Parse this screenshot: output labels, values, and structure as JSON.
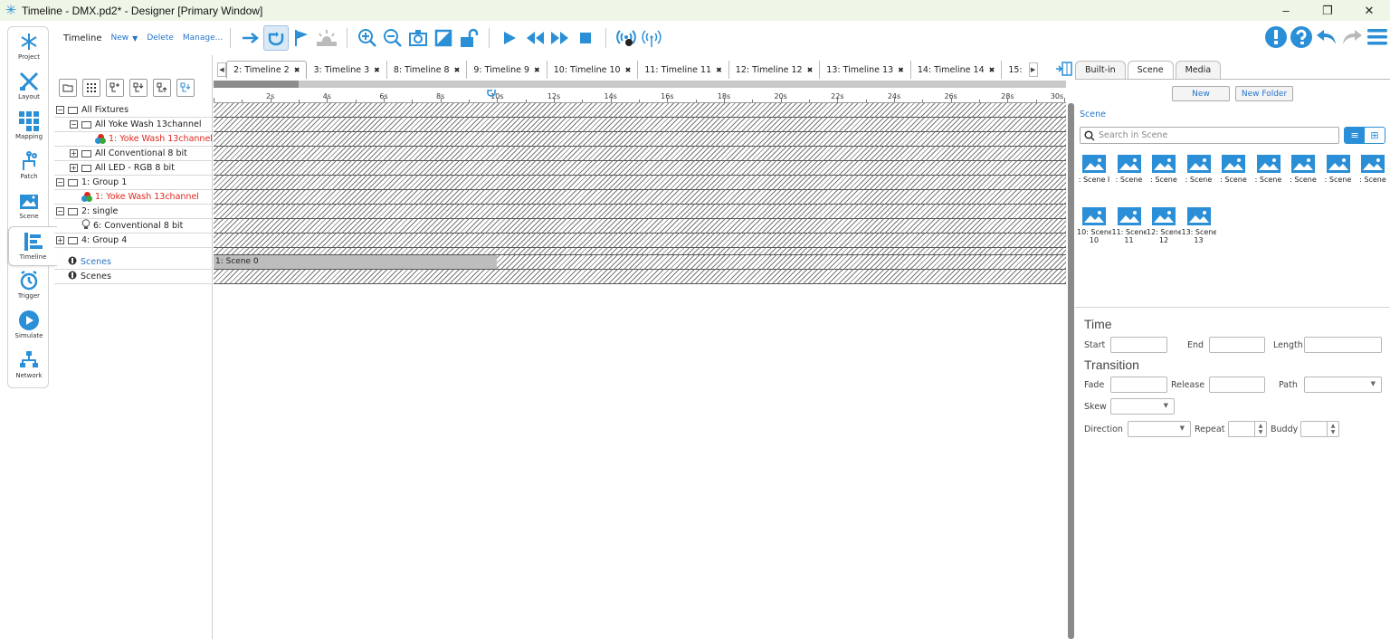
{
  "window": {
    "title": "Timeline - DMX.pd2* - Designer [Primary Window]",
    "minimize": "–",
    "maximize": "❐",
    "close": "✕"
  },
  "sidebar": {
    "items": [
      {
        "label": "Project",
        "icon": "project-icon"
      },
      {
        "label": "Layout",
        "icon": "layout-icon"
      },
      {
        "label": "Mapping",
        "icon": "mapping-icon"
      },
      {
        "label": "Patch",
        "icon": "patch-icon"
      },
      {
        "label": "Scene",
        "icon": "scene-icon"
      },
      {
        "label": "Timeline",
        "icon": "timeline-icon"
      },
      {
        "label": "Trigger",
        "icon": "trigger-icon"
      },
      {
        "label": "Simulate",
        "icon": "simulate-icon"
      },
      {
        "label": "Network",
        "icon": "network-icon"
      }
    ],
    "active": "Timeline"
  },
  "toolbar": {
    "title": "Timeline",
    "new_label": "New",
    "new_caret": "▼",
    "delete_label": "Delete",
    "manage_label": "Manage..."
  },
  "tree": {
    "rows": [
      {
        "label": "All Fixtures",
        "type": "folder",
        "pm": "⊟",
        "indent": 0,
        "red": false
      },
      {
        "label": "All Yoke Wash 13channel",
        "type": "folder",
        "pm": "⊟",
        "indent": 1,
        "red": false
      },
      {
        "label": "1: Yoke Wash 13channel",
        "type": "rgb",
        "pm": "",
        "indent": 2,
        "red": true
      },
      {
        "label": "All Conventional 8 bit",
        "type": "folder",
        "pm": "⊞",
        "indent": 1,
        "red": false
      },
      {
        "label": "All LED - RGB 8 bit",
        "type": "folder",
        "pm": "⊞",
        "indent": 1,
        "red": false
      },
      {
        "label": "1: Group 1",
        "type": "folder",
        "pm": "⊟",
        "indent": 0,
        "red": false
      },
      {
        "label": "1: Yoke Wash 13channel",
        "type": "rgb",
        "pm": "",
        "indent": 1,
        "red": true
      },
      {
        "label": "2: single",
        "type": "folder",
        "pm": "⊟",
        "indent": 0,
        "red": false
      },
      {
        "label": "6: Conventional 8 bit",
        "type": "bulb",
        "pm": "",
        "indent": 1,
        "red": false
      },
      {
        "label": "4: Group 4",
        "type": "folder",
        "pm": "⊞",
        "indent": 0,
        "red": false
      }
    ],
    "scene_rows": [
      {
        "label": "Scenes",
        "link": true
      },
      {
        "label": "Scenes",
        "link": false
      }
    ]
  },
  "timeline_tabs": [
    {
      "label": "2: Timeline 2",
      "active": true
    },
    {
      "label": "3: Timeline 3",
      "active": false
    },
    {
      "label": "8: Timeline 8",
      "active": false
    },
    {
      "label": "9: Timeline 9",
      "active": false
    },
    {
      "label": "10: Timeline 10",
      "active": false
    },
    {
      "label": "11: Timeline 11",
      "active": false
    },
    {
      "label": "12: Timeline 12",
      "active": false
    },
    {
      "label": "13: Timeline 13",
      "active": false
    },
    {
      "label": "14: Timeline 14",
      "active": false
    },
    {
      "label": "15:",
      "active": false
    }
  ],
  "tab_close": "✖",
  "ruler": {
    "labels": [
      "2s",
      "4s",
      "6s",
      "8s",
      "10s",
      "12s",
      "14s",
      "16s",
      "18s",
      "20s",
      "22s",
      "24s",
      "26s",
      "28s",
      "30s"
    ]
  },
  "scene_block": {
    "label": "1: Scene 0"
  },
  "right_panel": {
    "tabs": [
      {
        "label": "Built-in",
        "active": false
      },
      {
        "label": "Scene",
        "active": true
      },
      {
        "label": "Media",
        "active": false
      }
    ],
    "new_button": "New",
    "new_folder_button": "New Folder",
    "section": "Scene",
    "search_placeholder": "Search in Scene",
    "scenes_row1": [
      ": Scene I",
      ": Scene",
      ": Scene",
      ": Scene",
      ": Scene",
      ": Scene",
      ": Scene",
      ": Scene",
      ": Scene"
    ],
    "scenes_row2": [
      {
        "l1": "10: Scene",
        "l2": "10"
      },
      {
        "l1": "11: Scene",
        "l2": "11"
      },
      {
        "l1": "12: Scene",
        "l2": "12"
      },
      {
        "l1": "13: Scene",
        "l2": "13"
      }
    ],
    "time_heading": "Time",
    "start_label": "Start",
    "end_label": "End",
    "length_label": "Length",
    "transition_heading": "Transition",
    "fade_label": "Fade",
    "release_label": "Release",
    "path_label": "Path",
    "skew_label": "Skew",
    "direction_label": "Direction",
    "repeat_label": "Repeat",
    "buddy_label": "Buddy"
  },
  "colors": {
    "accent": "#2a8fd6",
    "link": "#2574c9",
    "red_item": "#e0261f",
    "titlebar_bg": "#eef6e8"
  }
}
